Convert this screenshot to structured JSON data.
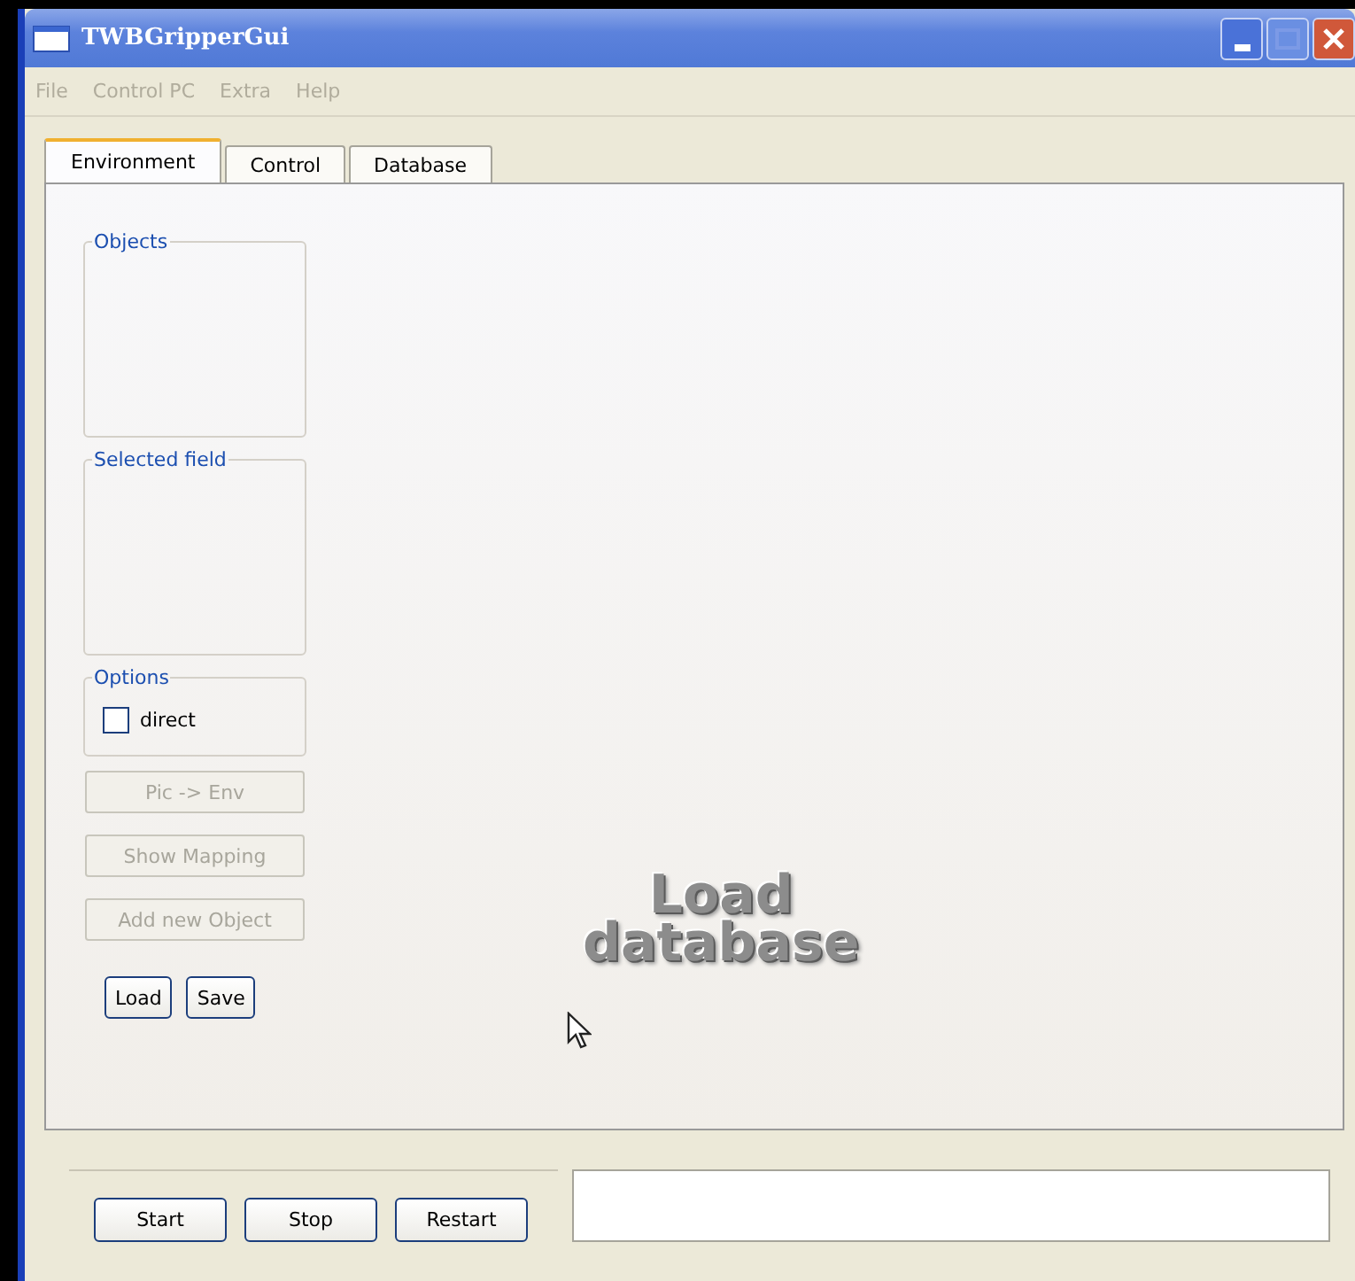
{
  "window": {
    "title": "TWBGripperGui"
  },
  "menu": [
    {
      "label": "File",
      "disabled": true
    },
    {
      "label": "Control PC",
      "disabled": true
    },
    {
      "label": "Extra",
      "disabled": true
    },
    {
      "label": "Help",
      "disabled": true
    }
  ],
  "tabs": [
    {
      "label": "Environment",
      "selected": true
    },
    {
      "label": "Control",
      "selected": false
    },
    {
      "label": "Database",
      "selected": false
    }
  ],
  "groups": [
    {
      "title": "Objects"
    },
    {
      "title": "Selected field"
    }
  ],
  "options": {
    "title": "Options",
    "checkboxes": [
      {
        "label": "direct",
        "checked": false
      }
    ]
  },
  "action_buttons": [
    {
      "label": "Pic -> Env",
      "disabled": true
    },
    {
      "label": "Show Mapping",
      "disabled": true
    },
    {
      "label": "Add new Object",
      "disabled": true
    }
  ],
  "file_buttons": [
    {
      "label": "Load",
      "disabled": false
    },
    {
      "label": "Save",
      "disabled": false
    }
  ],
  "overlay_text": "Load database",
  "bottom_buttons": [
    {
      "label": "Start",
      "disabled": false
    },
    {
      "label": "Stop",
      "disabled": false
    },
    {
      "label": "Restart",
      "disabled": false
    }
  ]
}
